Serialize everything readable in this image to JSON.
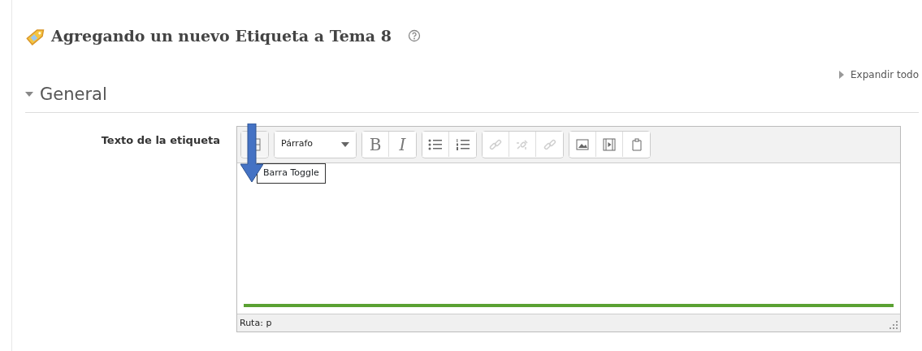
{
  "heading": {
    "title": "Agregando un nuevo Etiqueta a Tema 8"
  },
  "expand_all": "Expandir todo",
  "section": {
    "title": "General",
    "expanded": true
  },
  "field": {
    "label": "Texto de la etiqueta"
  },
  "editor": {
    "toolbar": [
      [
        {
          "kind": "toggle",
          "disabled": false
        }
      ],
      [
        {
          "kind": "dropdown",
          "value": "Párrafo",
          "disabled": false
        }
      ],
      [
        {
          "kind": "bold",
          "label": "B",
          "disabled": false
        },
        {
          "kind": "italic",
          "label": "I",
          "disabled": false
        }
      ],
      [
        {
          "kind": "bullets",
          "disabled": false
        },
        {
          "kind": "numbers",
          "disabled": false
        }
      ],
      [
        {
          "kind": "link",
          "disabled": true
        },
        {
          "kind": "unlink",
          "disabled": true
        },
        {
          "kind": "anchor",
          "disabled": true
        }
      ],
      [
        {
          "kind": "image",
          "disabled": false
        },
        {
          "kind": "media",
          "disabled": false
        },
        {
          "kind": "paste",
          "disabled": false
        }
      ]
    ],
    "tooltip": "Barra Toggle",
    "status": "Ruta: p"
  }
}
